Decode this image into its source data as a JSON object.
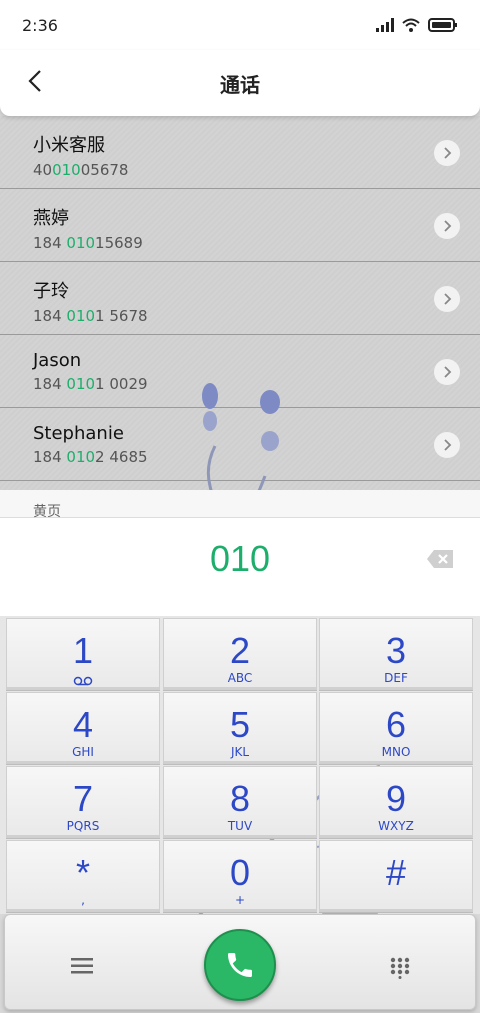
{
  "status_bar": {
    "time": "2:36"
  },
  "header": {
    "title": "通话"
  },
  "results": [
    {
      "name": "小米客服",
      "number_pre": "40",
      "number_hl": "010",
      "number_post": "05678"
    },
    {
      "name": "燕婷",
      "number_pre": "184 ",
      "number_hl": "010",
      "number_post": "15689"
    },
    {
      "name": "子玲",
      "number_pre": "184 ",
      "number_hl": "010",
      "number_post": "1 5678"
    },
    {
      "name": "Jason",
      "number_pre": "184 ",
      "number_hl": "010",
      "number_post": "1 0029"
    },
    {
      "name": "Stephanie",
      "number_pre": "184 ",
      "number_hl": "010",
      "number_post": "2 4685"
    }
  ],
  "yellow_pages": {
    "label": "黄页"
  },
  "dial_input": {
    "value": "010"
  },
  "keypad": [
    {
      "digit": "1",
      "letters": ""
    },
    {
      "digit": "2",
      "letters": "ABC"
    },
    {
      "digit": "3",
      "letters": "DEF"
    },
    {
      "digit": "4",
      "letters": "GHI"
    },
    {
      "digit": "5",
      "letters": "JKL"
    },
    {
      "digit": "6",
      "letters": "MNO"
    },
    {
      "digit": "7",
      "letters": "PQRS"
    },
    {
      "digit": "8",
      "letters": "TUV"
    },
    {
      "digit": "9",
      "letters": "WXYZ"
    },
    {
      "digit": "*",
      "letters": ","
    },
    {
      "digit": "0",
      "letters": "+"
    },
    {
      "digit": "#",
      "letters": ""
    }
  ],
  "colors": {
    "accent_green": "#1eae6c",
    "key_blue": "#2d48c6",
    "call_green": "#2bb866"
  },
  "icons": {
    "back": "chevron-left-icon",
    "chevron": "chevron-right-icon",
    "backspace": "backspace-icon",
    "voicemail": "voicemail-icon",
    "menu": "menu-icon",
    "call": "phone-icon",
    "dialpad": "dialpad-icon"
  }
}
